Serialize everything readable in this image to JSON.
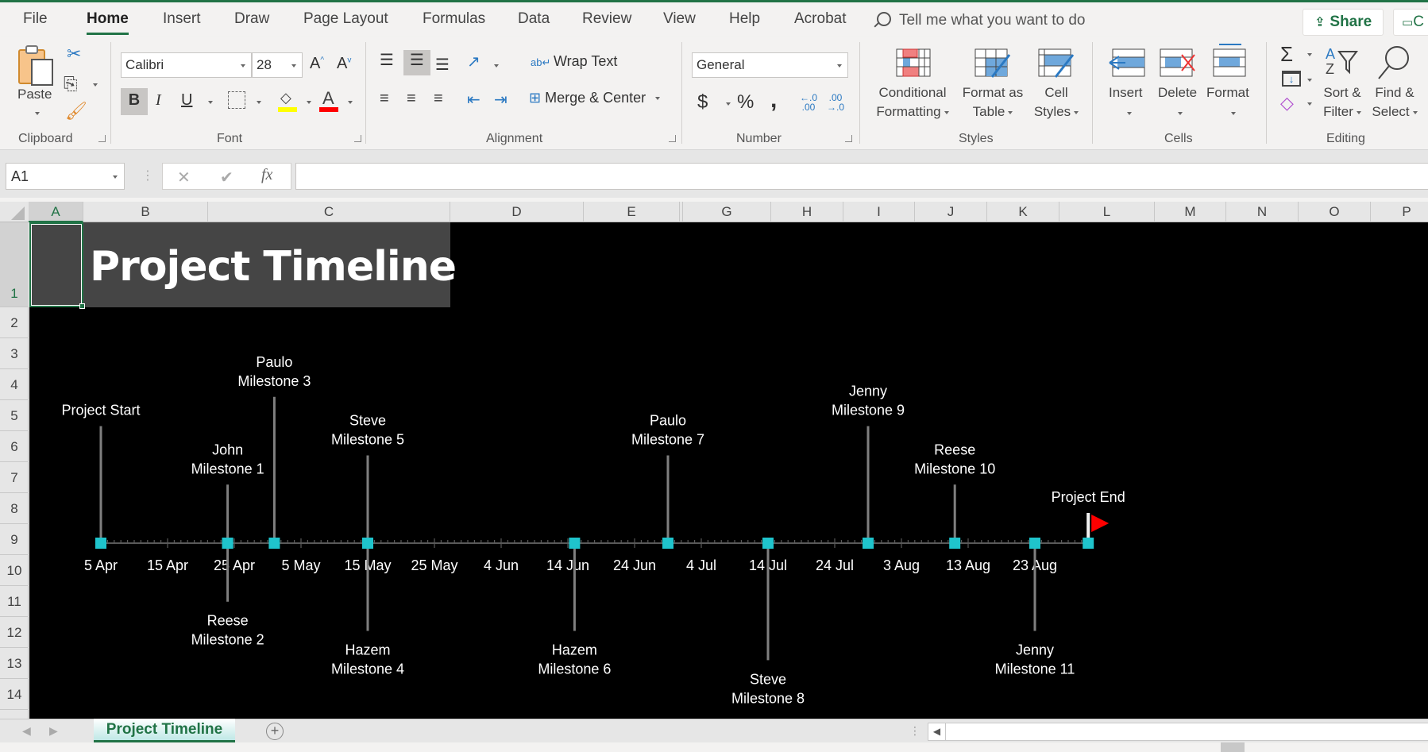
{
  "menu": {
    "tabs": [
      "File",
      "Home",
      "Insert",
      "Draw",
      "Page Layout",
      "Formulas",
      "Data",
      "Review",
      "View",
      "Help",
      "Acrobat"
    ],
    "active_tab": "Home",
    "tell_me": "Tell me what you want to do",
    "share": "Share",
    "comments": "C"
  },
  "ribbon": {
    "clipboard": {
      "label": "Clipboard",
      "paste": "Paste"
    },
    "font": {
      "label": "Font",
      "font_name": "Calibri",
      "font_size": "28",
      "bold": "B",
      "italic": "I",
      "underline": "U",
      "grow": "A",
      "shrink": "A",
      "highlight_color": "#ffff00",
      "font_color": "#ff0000"
    },
    "alignment": {
      "label": "Alignment",
      "wrap_text": "Wrap Text",
      "merge_center": "Merge & Center"
    },
    "number": {
      "label": "Number",
      "format": "General",
      "currency": "$",
      "percent": "%",
      "comma": ",",
      "inc_decimal": "←.0 .00",
      "dec_decimal": ".00 →.0"
    },
    "styles": {
      "label": "Styles",
      "conditional_formatting": [
        "Conditional",
        "Formatting"
      ],
      "format_as_table": [
        "Format as",
        "Table"
      ],
      "cell_styles": [
        "Cell",
        "Styles"
      ]
    },
    "cells": {
      "label": "Cells",
      "insert": "Insert",
      "delete": "Delete",
      "format": "Format"
    },
    "editing": {
      "label": "Editing",
      "autosum": "Σ",
      "sort_filter": [
        "Sort &",
        "Filter"
      ],
      "find_select": [
        "Find &",
        "Select"
      ]
    }
  },
  "formula_bar": {
    "name_box": "A1",
    "cancel": "✕",
    "enter": "✔",
    "fx": "fx",
    "value": ""
  },
  "grid": {
    "columns": [
      "A",
      "B",
      "C",
      "D",
      "E",
      "G",
      "H",
      "I",
      "J",
      "K",
      "L",
      "M",
      "N",
      "O",
      "P"
    ],
    "rows": [
      "1",
      "2",
      "3",
      "4",
      "5",
      "6",
      "7",
      "8",
      "9",
      "10",
      "11",
      "12",
      "13",
      "14"
    ],
    "selected_cell": "A1"
  },
  "sheet": {
    "title": "Project Timeline"
  },
  "chart_data": {
    "type": "scatter",
    "title": "",
    "xlabel": "",
    "ylabel": "",
    "x_axis_ticks": [
      "5 Apr",
      "15 Apr",
      "25 Apr",
      "5 May",
      "15 May",
      "25 May",
      "4 Jun",
      "14 Jun",
      "24 Jun",
      "4 Jul",
      "14 Jul",
      "24 Jul",
      "3 Aug",
      "13 Aug",
      "23 Aug"
    ],
    "x_range_days_from_5_apr": [
      0,
      148
    ],
    "tick_interval_days": 10,
    "minor_tick_interval_days": 1,
    "marker_color": "#1fc4cc",
    "stem_color": "#7f7f7f",
    "background": "#000000",
    "label_color": "#ffffff",
    "end_flag_color": "#ff0000",
    "milestones": [
      {
        "label": [
          "Project Start"
        ],
        "date": "5 Apr",
        "day": 0,
        "height": 4.4
      },
      {
        "label": [
          "John",
          "Milestone 1"
        ],
        "date": "24 Apr",
        "day": 19,
        "height": 2.2
      },
      {
        "label": [
          "Reese",
          "Milestone 2"
        ],
        "date": "24 Apr",
        "day": 19,
        "height": -2.2
      },
      {
        "label": [
          "Paulo",
          "Milestone 3"
        ],
        "date": "1 May",
        "day": 26,
        "height": 5.5
      },
      {
        "label": [
          "Hazem",
          "Milestone 4"
        ],
        "date": "15 May",
        "day": 40,
        "height": -3.3
      },
      {
        "label": [
          "Steve",
          "Milestone 5"
        ],
        "date": "15 May",
        "day": 40,
        "height": 3.3
      },
      {
        "label": [
          "Hazem",
          "Milestone 6"
        ],
        "date": "15 Jun",
        "day": 71,
        "height": -3.3
      },
      {
        "label": [
          "Paulo",
          "Milestone 7"
        ],
        "date": "29 Jun",
        "day": 85,
        "height": 3.3
      },
      {
        "label": [
          "Steve",
          "Milestone 8"
        ],
        "date": "14 Jul",
        "day": 100,
        "height": -4.4
      },
      {
        "label": [
          "Jenny",
          "Milestone 9"
        ],
        "date": "29 Jul",
        "day": 115,
        "height": 4.4
      },
      {
        "label": [
          "Reese",
          "Milestone 10"
        ],
        "date": "11 Aug",
        "day": 128,
        "height": 2.2
      },
      {
        "label": [
          "Jenny",
          "Milestone 11"
        ],
        "date": "23 Aug",
        "day": 140,
        "height": -3.3
      },
      {
        "label": [
          "Project End"
        ],
        "date": "31 Aug",
        "day": 148,
        "height": 0.9,
        "flag": true
      }
    ]
  },
  "sheet_tabs": {
    "tabs": [
      "Project Timeline"
    ],
    "active": "Project Timeline",
    "add": "+"
  }
}
